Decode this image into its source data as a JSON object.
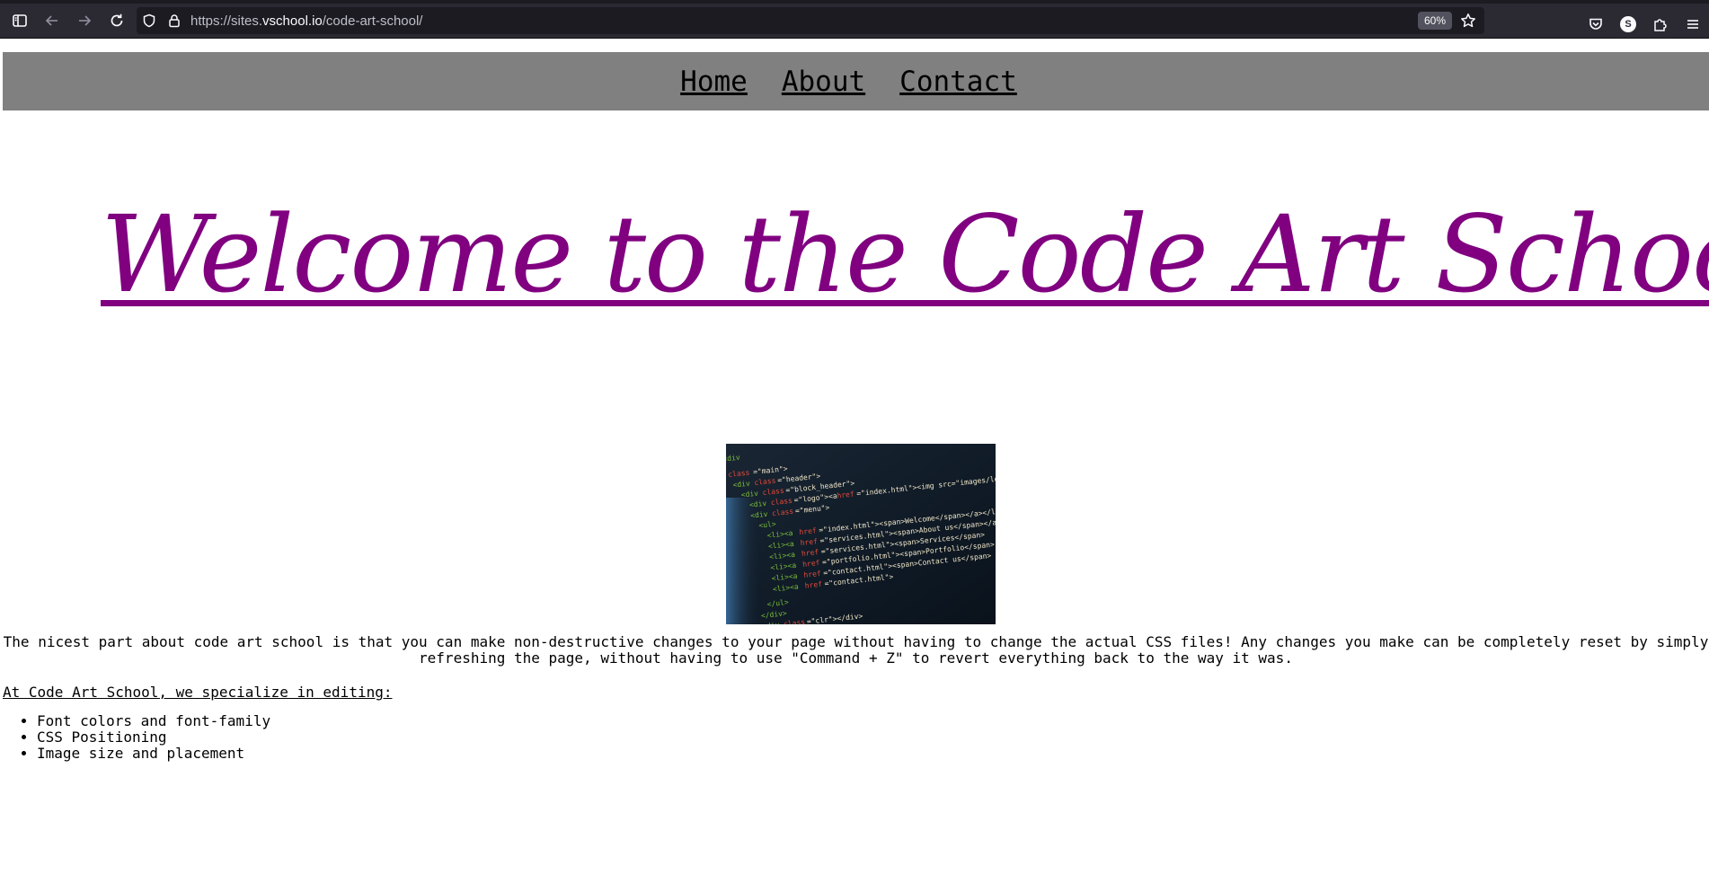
{
  "browser": {
    "url_prefix": "https://sites.",
    "url_host": "vschool.io",
    "url_path": "/code-art-school/",
    "zoom": "60%",
    "account_initial": "S"
  },
  "nav": {
    "links": [
      "Home",
      "About",
      "Contact"
    ]
  },
  "hero": {
    "title": "Welcome to the Code Art School!"
  },
  "content": {
    "intro": "The nicest part about code art school is that you can make non-destructive changes to your page without having to change the actual CSS files! Any changes you make can be completely reset by simply refreshing the page, without having to use \"Command + Z\" to revert everything back to the way it was.",
    "specialize_heading": "At Code Art School, we specialize in editing:",
    "skills": [
      "Font colors and font-family",
      "CSS Positioning",
      "Image size and placement"
    ]
  },
  "colors": {
    "title": "#800080",
    "nav_bar": "#808080"
  }
}
